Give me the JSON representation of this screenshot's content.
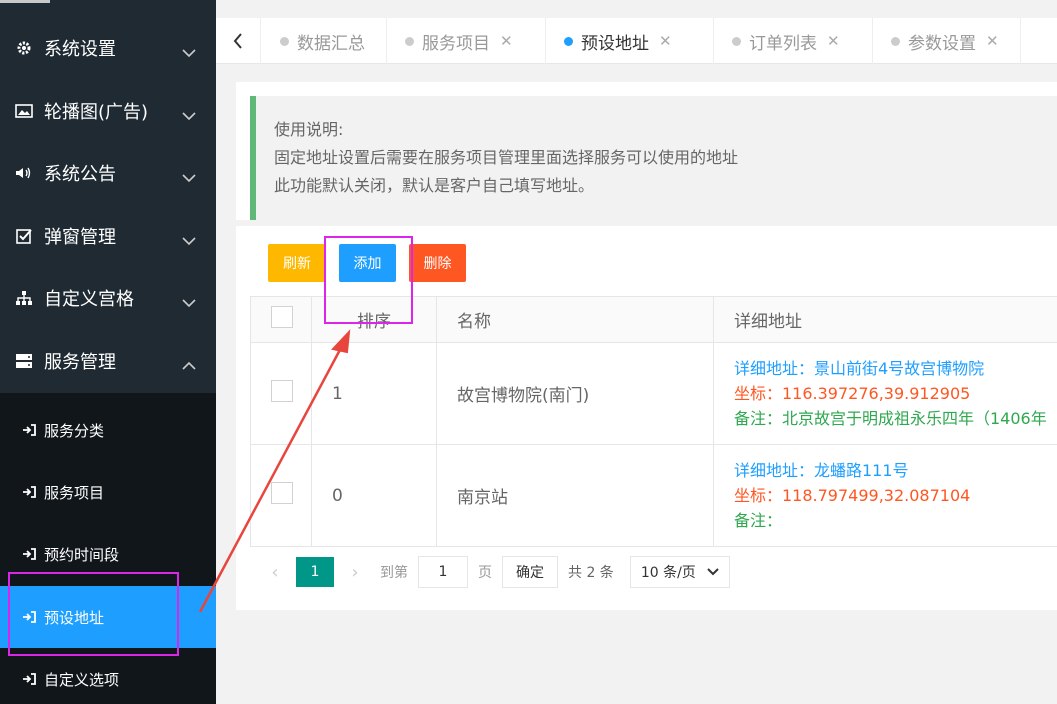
{
  "sidebar": {
    "items": [
      {
        "label": "系统设置",
        "icon": "gear-icon"
      },
      {
        "label": "轮播图(广告)",
        "icon": "image-icon"
      },
      {
        "label": "系统公告",
        "icon": "speaker-icon"
      },
      {
        "label": "弹窗管理",
        "icon": "check-square-icon"
      },
      {
        "label": "自定义宫格",
        "icon": "sitemap-icon"
      },
      {
        "label": "服务管理",
        "icon": "server-icon"
      }
    ],
    "sub_items": [
      {
        "label": "服务分类"
      },
      {
        "label": "服务项目"
      },
      {
        "label": "预约时间段"
      },
      {
        "label": "预设地址",
        "active": true
      },
      {
        "label": "自定义选项"
      }
    ]
  },
  "tabs": [
    {
      "label": "数据汇总",
      "closable": false
    },
    {
      "label": "服务项目",
      "closable": true
    },
    {
      "label": "预设地址",
      "closable": true,
      "active": true
    },
    {
      "label": "订单列表",
      "closable": true
    },
    {
      "label": "参数设置",
      "closable": true
    }
  ],
  "notice": {
    "line1": "使用说明:",
    "line2": "固定地址设置后需要在服务项目管理里面选择服务可以使用的地址",
    "line3": "此功能默认关闭，默认是客户自己填写地址。"
  },
  "toolbar": {
    "refresh": "刷新",
    "add": "添加",
    "delete": "删除"
  },
  "table": {
    "headers": {
      "sort": "排序",
      "name": "名称",
      "address": "详细地址"
    },
    "rows": [
      {
        "sort": "1",
        "name": "故宫博物院(南门)",
        "address": "详细地址：景山前街4号故宫博物院",
        "coords": "坐标：116.397276,39.912905",
        "note": "备注：北京故宫于明成祖永乐四年（1406年"
      },
      {
        "sort": "0",
        "name": "南京站",
        "address": "详细地址：龙蟠路111号",
        "coords": "坐标：118.797499,32.087104",
        "note": "备注："
      }
    ]
  },
  "pager": {
    "current": "1",
    "goto_label": "到第",
    "goto_value": "1",
    "page_label": "页",
    "confirm": "确定",
    "total": "共 2 条",
    "page_size": "10 条/页"
  },
  "colors": {
    "accent": "#1e9fff",
    "success": "#5fb878",
    "pager_active": "#009688",
    "annotation": "#d926e8",
    "arrow": "#e8453c"
  }
}
